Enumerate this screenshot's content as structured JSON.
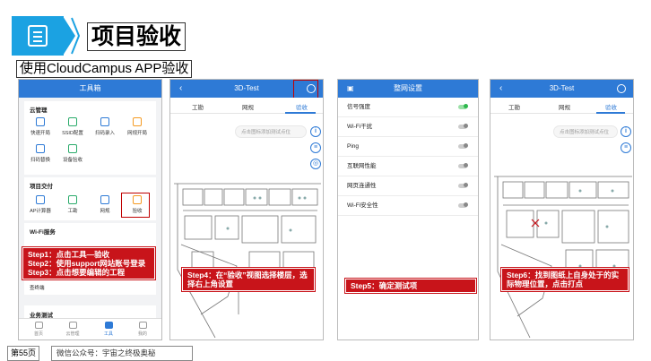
{
  "header": {
    "title": "项目验收",
    "subtitle": "使用CloudCampus APP验收"
  },
  "colors": {
    "accent": "#1ba2e2",
    "app_blue": "#2e7ad6",
    "callout_red": "#c8141a",
    "toggle_on": "#2db84d"
  },
  "phone1": {
    "title": "工具箱",
    "cloud_section": {
      "title": "云管理",
      "tools": [
        {
          "label": "快速开局",
          "icon": "quick-start-icon"
        },
        {
          "label": "SSID配置",
          "icon": "ssid-icon"
        },
        {
          "label": "扫码录入",
          "icon": "scan-input-icon"
        },
        {
          "label": "网规开局",
          "icon": "network-plan-icon"
        },
        {
          "label": "扫码替换",
          "icon": "scan-replace-icon"
        },
        {
          "label": "设备验收",
          "icon": "device-accept-icon"
        }
      ]
    },
    "project_section": {
      "title": "项目交付",
      "tools": [
        {
          "label": "AP计算器",
          "icon": "ap-calculator-icon"
        },
        {
          "label": "工勘",
          "icon": "survey-icon"
        },
        {
          "label": "网规",
          "icon": "network-plan-icon"
        },
        {
          "label": "验收",
          "icon": "acceptance-icon"
        }
      ]
    },
    "wifi_section": {
      "title": "Wi-Fi服务"
    },
    "extra_item": "查终端",
    "biz_section": {
      "title": "业务测试"
    },
    "tabs": [
      "首页",
      "云管理",
      "工具",
      "我的"
    ],
    "callout": [
      "Step1：点击工具—验收",
      "Step2：使用support网站账号登录",
      "Step3：点击想要编辑的工程"
    ]
  },
  "phone2": {
    "title": "3D-Test",
    "tabs": [
      "工勘",
      "网规",
      "验收"
    ],
    "hint": "点击图标添加测试点位",
    "callout": "Step4：在“验收”视图选择楼层，选择右上角设置"
  },
  "phone3": {
    "title": "整网设置",
    "rows": [
      {
        "label": "信号强度",
        "on": true
      },
      {
        "label": "Wi-Fi干扰",
        "on": false
      },
      {
        "label": "Ping",
        "on": false
      },
      {
        "label": "互联网性能",
        "on": false
      },
      {
        "label": "网页连通性",
        "on": false
      },
      {
        "label": "Wi-Fi安全性",
        "on": false
      }
    ],
    "callout": "Step5：确定测试项"
  },
  "phone4": {
    "title": "3D-Test",
    "tabs": [
      "工勘",
      "网规",
      "验收"
    ],
    "hint": "点击图标添加测试点位",
    "callout": "Step6：找到图纸上自身处于的实际物理位置，点击打点"
  },
  "footer": {
    "page": "第55页",
    "account": "微信公众号：宇宙之终极奥秘"
  }
}
